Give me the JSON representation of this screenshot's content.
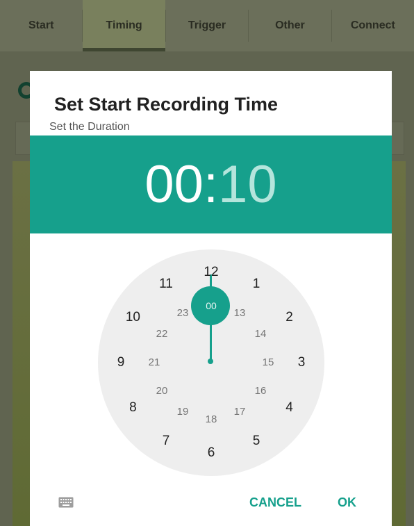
{
  "tabs": [
    {
      "label": "Start"
    },
    {
      "label": "Timing"
    },
    {
      "label": "Trigger"
    },
    {
      "label": "Other"
    },
    {
      "label": "Connect"
    }
  ],
  "dialog": {
    "title": "Set Start Recording Time",
    "subtitle": "Set the Duration",
    "time": {
      "hours": "00",
      "separator": ":",
      "minutes": "10"
    },
    "clock": {
      "outer": [
        "12",
        "1",
        "2",
        "3",
        "4",
        "5",
        "6",
        "7",
        "8",
        "9",
        "10",
        "11"
      ],
      "inner": [
        "00",
        "13",
        "14",
        "15",
        "16",
        "17",
        "18",
        "19",
        "20",
        "21",
        "22",
        "23"
      ],
      "selected": "00"
    },
    "keyboard_icon": "keyboard-icon",
    "cancel_label": "CANCEL",
    "ok_label": "OK"
  },
  "colors": {
    "accent": "#16a08c",
    "accent_light": "#b4e5dc",
    "clock_face": "#eeeeee"
  }
}
